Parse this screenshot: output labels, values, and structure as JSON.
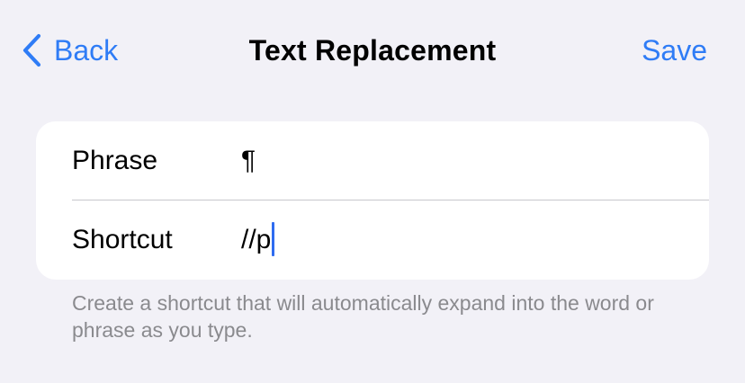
{
  "nav": {
    "back_label": "Back",
    "title": "Text Replacement",
    "save_label": "Save"
  },
  "form": {
    "phrase": {
      "label": "Phrase",
      "value": "¶"
    },
    "shortcut": {
      "label": "Shortcut",
      "value": "//p"
    }
  },
  "footer": {
    "note": "Create a shortcut that will automatically expand into the word or phrase as you type."
  },
  "colors": {
    "accent": "#2f7cf6",
    "background": "#f2f1f7",
    "card": "#ffffff",
    "secondary_text": "#8a8a8e"
  },
  "icons": {
    "back": "chevron-left-icon"
  }
}
